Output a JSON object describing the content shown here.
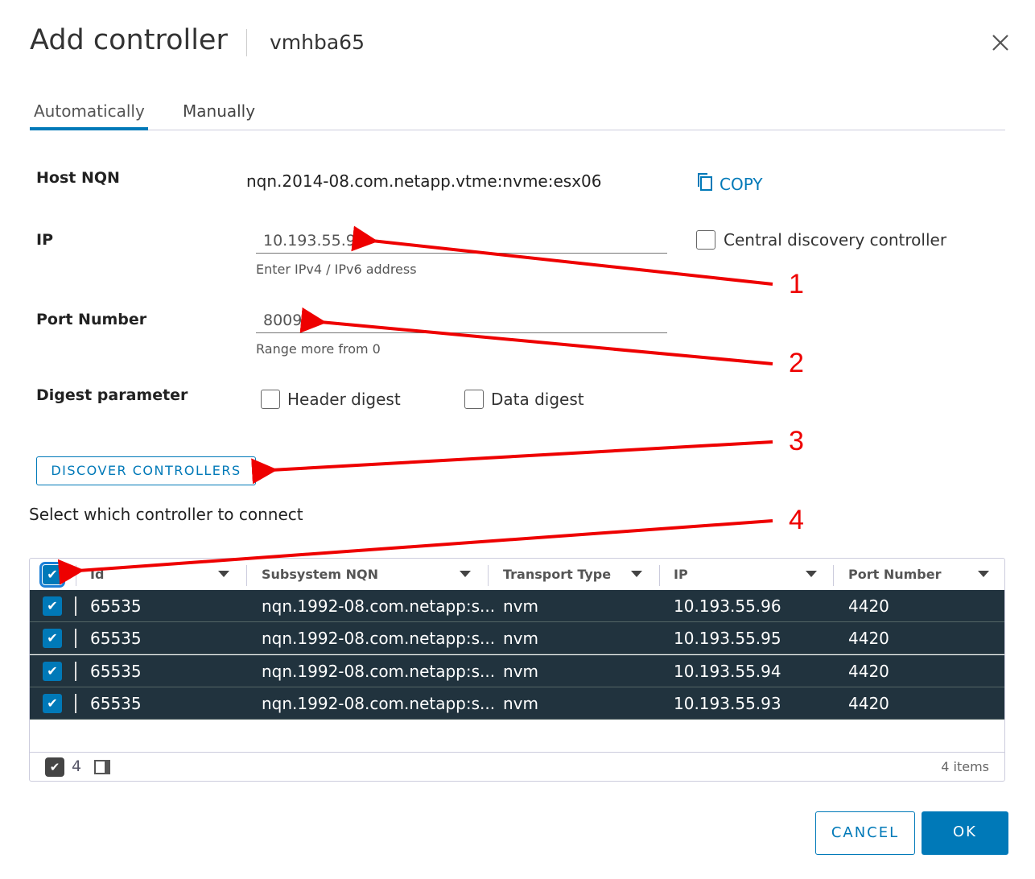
{
  "dialog": {
    "title": "Add controller",
    "subtitle": "vmhba65"
  },
  "tabs": [
    {
      "label": "Automatically",
      "active": true
    },
    {
      "label": "Manually",
      "active": false
    }
  ],
  "form": {
    "host_nqn_label": "Host NQN",
    "host_nqn_value": "nqn.2014-08.com.netapp.vtme:nvme:esx06",
    "copy_label": "COPY",
    "ip_label": "IP",
    "ip_value": "10.193.55.93",
    "ip_help": "Enter IPv4 / IPv6 address",
    "central_discovery_label": "Central discovery controller",
    "central_discovery_checked": false,
    "port_label": "Port Number",
    "port_value": "8009",
    "port_help": "Range more from 0",
    "digest_label": "Digest parameter",
    "header_digest_label": "Header digest",
    "data_digest_label": "Data digest",
    "discover_button": "DISCOVER CONTROLLERS",
    "select_prompt": "Select which controller to connect"
  },
  "table": {
    "columns": [
      "Id",
      "Subsystem NQN",
      "Transport Type",
      "IP",
      "Port Number"
    ],
    "rows": [
      {
        "id": "65535",
        "nqn": "nqn.1992-08.com.netapp:s...",
        "transport": "nvm",
        "ip": "10.193.55.96",
        "port": "4420"
      },
      {
        "id": "65535",
        "nqn": "nqn.1992-08.com.netapp:s...",
        "transport": "nvm",
        "ip": "10.193.55.95",
        "port": "4420"
      },
      {
        "id": "65535",
        "nqn": "nqn.1992-08.com.netapp:s...",
        "transport": "nvm",
        "ip": "10.193.55.94",
        "port": "4420"
      },
      {
        "id": "65535",
        "nqn": "nqn.1992-08.com.netapp:s...",
        "transport": "nvm",
        "ip": "10.193.55.93",
        "port": "4420"
      }
    ],
    "selected_count": "4",
    "items_label": "4 items"
  },
  "buttons": {
    "cancel": "CANCEL",
    "ok": "OK"
  },
  "annotations": [
    "1",
    "2",
    "3",
    "4"
  ],
  "colors": {
    "accent": "#0079b8",
    "row_selected": "#21333e",
    "annotation": "#ee0000"
  }
}
